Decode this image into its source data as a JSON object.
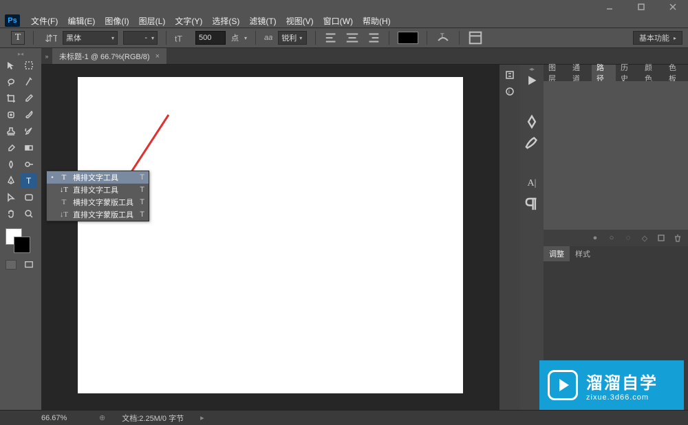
{
  "app": {
    "logo": "Ps"
  },
  "window_buttons": {
    "min": "–",
    "max": "□",
    "close": "×"
  },
  "menu": [
    "文件(F)",
    "编辑(E)",
    "图像(I)",
    "图层(L)",
    "文字(Y)",
    "选择(S)",
    "滤镜(T)",
    "视图(V)",
    "窗口(W)",
    "帮助(H)"
  ],
  "options": {
    "tool_letter": "T",
    "font_family": "黑体",
    "font_style": "-",
    "size_value": "500",
    "size_unit": "点",
    "aa_label": "锐利",
    "workspace": "基本功能"
  },
  "doctab": {
    "title": "未标题-1 @ 66.7%(RGB/8)",
    "close": "×"
  },
  "panel_tabs_top": [
    "图层",
    "通道",
    "路径",
    "历史",
    "颜色",
    "色板"
  ],
  "panel_tabs_top_active": 2,
  "panel_tabs_mid": {
    "adjust": "调整",
    "styles": "样式"
  },
  "status": {
    "zoom": "66.67%",
    "doc": "文档:2.25M/0 字节"
  },
  "flyout": {
    "items": [
      {
        "icon": "T",
        "label": "横排文字工具",
        "shortcut": "T",
        "selected": true
      },
      {
        "icon": "↓T",
        "label": "直排文字工具",
        "shortcut": "T",
        "selected": false
      },
      {
        "icon": "T̈",
        "label": "横排文字蒙版工具",
        "shortcut": "T",
        "selected": false
      },
      {
        "icon": "↓T̈",
        "label": "直排文字蒙版工具",
        "shortcut": "T",
        "selected": false
      }
    ]
  },
  "watermark": {
    "title": "溜溜自学",
    "sub": "zixue.3d66.com"
  },
  "icons": {
    "aa": "aa"
  }
}
